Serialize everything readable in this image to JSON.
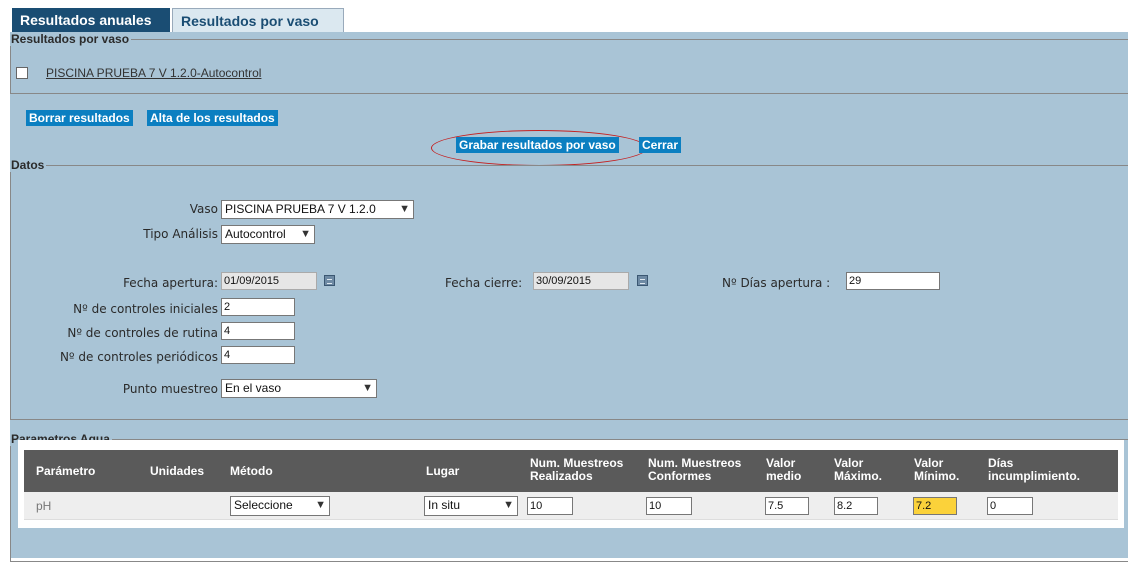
{
  "tabs": [
    {
      "label": "Resultados anuales",
      "active": true
    },
    {
      "label": "Resultados por vaso",
      "active": false
    }
  ],
  "pools_section": {
    "legend": "Resultados por vaso",
    "pool_label": "PISCINA PRUEBA 7 V 1.2.0-Autocontrol",
    "checked": false
  },
  "actions": {
    "delete": "Borrar resultados",
    "add": "Alta de los resultados",
    "save": "Grabar resultados por vaso",
    "close": "Cerrar"
  },
  "datos": {
    "legend": "Datos",
    "vaso_label": "Vaso",
    "vaso_value": "PISCINA PRUEBA 7 V 1.2.0",
    "tipo_label": "Tipo Análisis",
    "tipo_value": "Autocontrol",
    "fecha_apertura_label": "Fecha apertura:",
    "fecha_apertura_value": "01/09/2015",
    "fecha_cierre_label": "Fecha cierre:",
    "fecha_cierre_value": "30/09/2015",
    "dias_apertura_label": "Nº Días apertura :",
    "dias_apertura_value": "29",
    "controles_iniciales_label": "Nº de controles iniciales",
    "controles_iniciales_value": "2",
    "controles_rutina_label": "Nº de controles de rutina",
    "controles_rutina_value": "4",
    "controles_periodicos_label": "Nº de controles periódicos",
    "controles_periodicos_value": "4",
    "punto_label": "Punto muestreo",
    "punto_value": "En el vaso"
  },
  "agua": {
    "legend": "Parametros Agua",
    "headers": {
      "parametro": "Parámetro",
      "unidades": "Unidades",
      "metodo": "Método",
      "lugar": "Lugar",
      "realizados_1": "Num. Muestreos",
      "realizados_2": "Realizados",
      "conformes_1": "Num. Muestreos",
      "conformes_2": "Conformes",
      "medio_1": "Valor",
      "medio_2": "medio",
      "maximo_1": "Valor",
      "maximo_2": "Máximo.",
      "minimo_1": "Valor",
      "minimo_2": "Mínimo.",
      "dias_1": "Días",
      "dias_2": "incumplimiento."
    },
    "row": {
      "parametro": "pH",
      "metodo": "Seleccione",
      "lugar": "In situ",
      "realizados": "10",
      "conformes": "10",
      "medio": "7.5",
      "maximo": "8.2",
      "minimo": "7.2",
      "dias": "0"
    }
  },
  "colors": {
    "panel_bg": "#a9c4d6",
    "tab_active": "#1a4d73",
    "link_button": "#0b7fc1",
    "header_bg": "#5a5a5a",
    "highlight": "#fbd23a",
    "annotation": "#c42020"
  }
}
